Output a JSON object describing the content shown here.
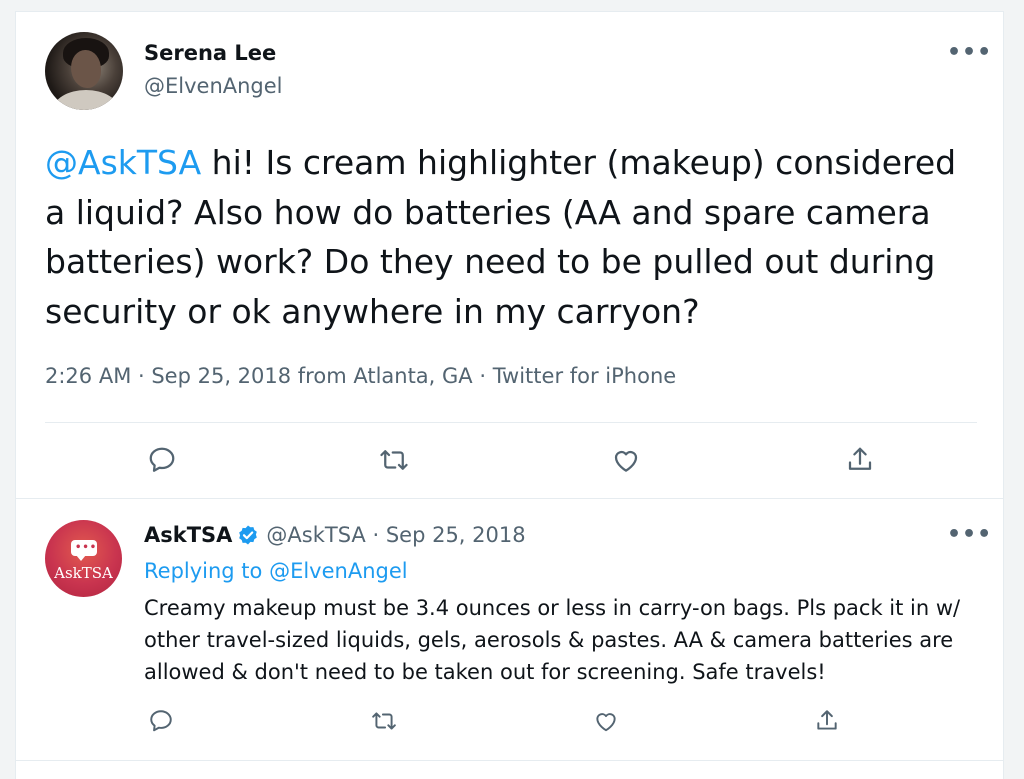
{
  "tweet": {
    "author_name": "Serena Lee",
    "author_handle": "@ElvenAngel",
    "more_label": "•••",
    "text_mention": "@AskTSA",
    "text_body": " hi! Is cream highlighter (makeup) considered a liquid? Also how do batteries (AA and spare camera batteries) work? Do they need to be pulled out during security or ok anywhere in my carryon?",
    "timestamp": "2:26 AM · Sep 25, 2018 from Atlanta, GA · Twitter for iPhone",
    "actions": [
      "reply-icon",
      "retweet-icon",
      "like-icon",
      "share-icon"
    ]
  },
  "reply": {
    "author_name": "AskTSA",
    "verified": true,
    "handle_date": "@AskTSA · Sep 25, 2018",
    "more_label": "•••",
    "replying_prefix": "Replying to ",
    "replying_to": "@ElvenAngel",
    "text": "Creamy makeup must be 3.4 ounces or less in carry-on bags. Pls pack it in w/ other travel-sized liquids, gels, aerosols & pastes. AA & camera batteries are allowed & don't need to be taken out for screening. Safe travels!",
    "avatar_label": "AskTSA",
    "actions": [
      "reply-icon",
      "retweet-icon",
      "like-icon",
      "share-icon"
    ]
  },
  "colors": {
    "accent": "#1d9bf0",
    "text": "#0f1419",
    "secondary": "#536471",
    "tsa_avatar": "#c9344f"
  }
}
